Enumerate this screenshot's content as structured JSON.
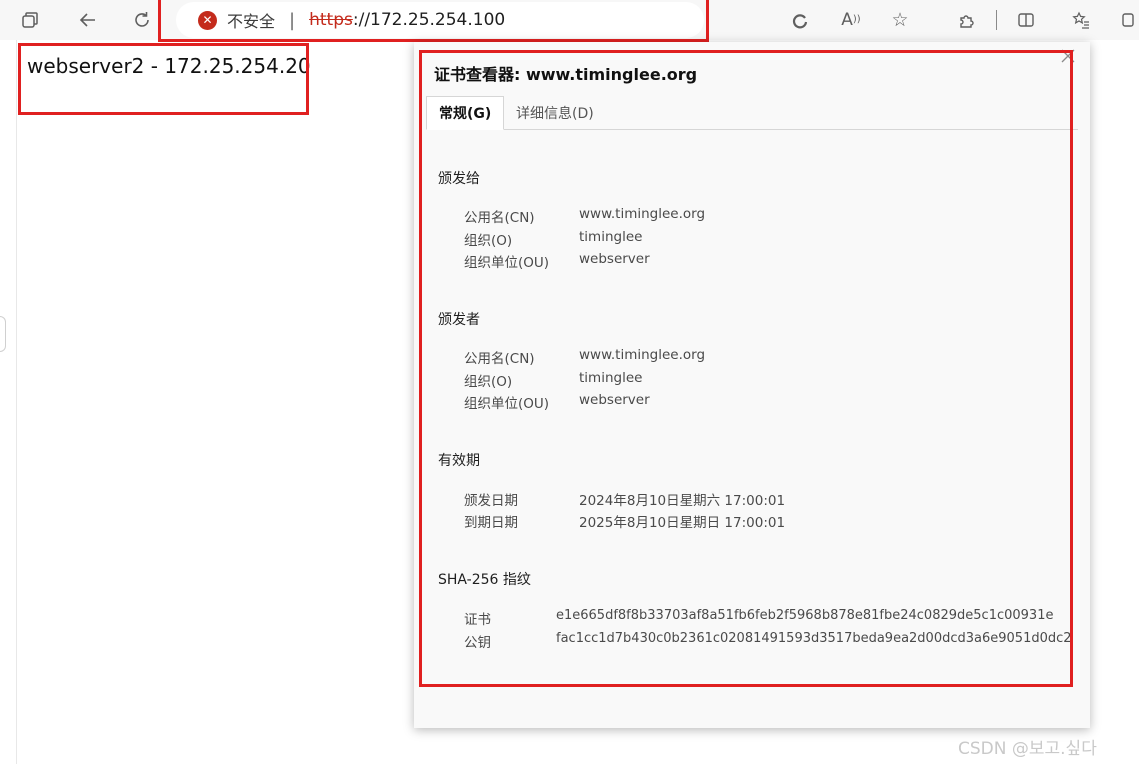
{
  "browser": {
    "security_label": "不安全",
    "url_scheme": "https",
    "url_rest": "://172.25.254.100"
  },
  "page": {
    "text": "webserver2 - 172.25.254.20"
  },
  "dialog": {
    "title": "证书查看器: www.timinglee.org",
    "tabs": [
      {
        "label": "常规(G)"
      },
      {
        "label": "详细信息(D)"
      }
    ],
    "issued_to": {
      "heading": "颁发给",
      "rows": [
        {
          "key": "公用名(CN)",
          "value": "www.timinglee.org"
        },
        {
          "key": "组织(O)",
          "value": "timinglee"
        },
        {
          "key": "组织单位(OU)",
          "value": "webserver"
        }
      ]
    },
    "issued_by": {
      "heading": "颁发者",
      "rows": [
        {
          "key": "公用名(CN)",
          "value": "www.timinglee.org"
        },
        {
          "key": "组织(O)",
          "value": "timinglee"
        },
        {
          "key": "组织单位(OU)",
          "value": "webserver"
        }
      ]
    },
    "validity": {
      "heading": "有效期",
      "rows": [
        {
          "key": "颁发日期",
          "value": "2024年8月10日星期六 17:00:01"
        },
        {
          "key": "到期日期",
          "value": "2025年8月10日星期日 17:00:01"
        }
      ]
    },
    "fingerprints": {
      "heading": "SHA-256 指纹",
      "rows": [
        {
          "key": "证书",
          "value": "e1e665df8f8b33703af8a51fb6feb2f5968b878e81fbe24c0829de5c1c00931e"
        },
        {
          "key": "公钥",
          "value": "fac1cc1d7b430c0b2361c02081491593d3517beda9ea2d00dcd3a6e9051d0dc2"
        }
      ]
    }
  },
  "watermark": "CSDN @보고.싶다",
  "colors": {
    "annotation": "#e02020",
    "insecure": "#c42b1c"
  }
}
